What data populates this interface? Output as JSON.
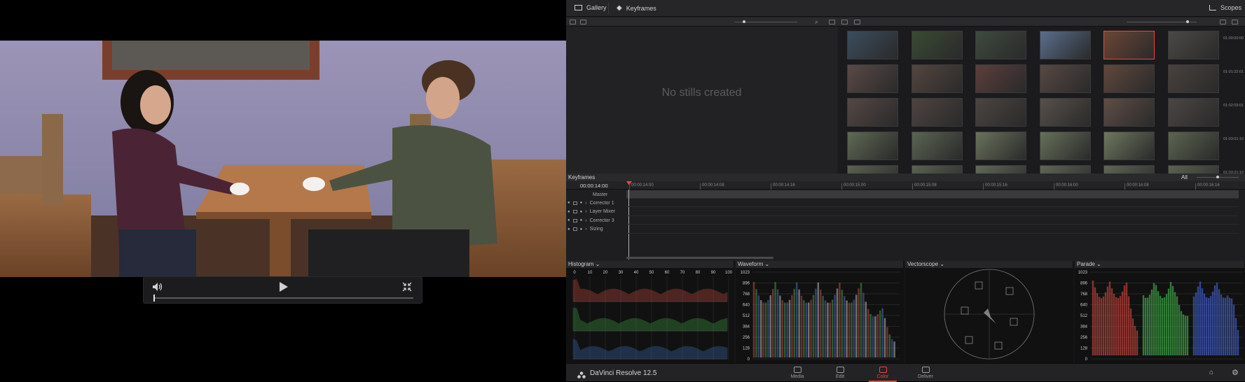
{
  "app": {
    "title": "DaVinci Resolve 12.5"
  },
  "topbar": {
    "gallery": "Gallery",
    "keyframes": "Keyframes",
    "scopes": "Scopes"
  },
  "stills": {
    "empty_message": "No stills created"
  },
  "thumb_timecodes": [
    "01:00:00:00",
    "01:01:32:01",
    "01:02:09:01",
    "01:03:01:10",
    "01:03:21:10"
  ],
  "keyframes": {
    "title": "Keyframes",
    "filter": "All",
    "current_timecode": "00:00:14:00",
    "ruler": [
      "00:00:14:00",
      "00:00:14:08",
      "00:00:14:16",
      "00:00:15:00",
      "00:00:15:08",
      "00:00:15:16",
      "00:00:16:00",
      "00:00:16:08",
      "00:00:16:16"
    ],
    "master_label": "Master",
    "tracks": [
      "Corrector 1",
      "Layer Mixer",
      "Corrector 3",
      "Sizing"
    ]
  },
  "scopes": {
    "histogram": {
      "title": "Histogram",
      "ticks": [
        "0",
        "10",
        "20",
        "30",
        "40",
        "50",
        "60",
        "70",
        "80",
        "90",
        "100"
      ]
    },
    "waveform": {
      "title": "Waveform",
      "ticks": [
        "1023",
        "896",
        "768",
        "640",
        "512",
        "384",
        "256",
        "128",
        "0"
      ]
    },
    "vectorscope": {
      "title": "Vectorscope"
    },
    "parade": {
      "title": "Parade",
      "ticks": [
        "1023",
        "896",
        "768",
        "640",
        "512",
        "384",
        "256",
        "128",
        "0"
      ]
    }
  },
  "pages": [
    {
      "label": "Media",
      "active": false
    },
    {
      "label": "Edit",
      "active": false
    },
    {
      "label": "Color",
      "active": true
    },
    {
      "label": "Deliver",
      "active": false
    }
  ],
  "player": {
    "progress": 0.0
  },
  "colors": {
    "accent": "#e8483f",
    "panel": "#1f1f21",
    "active_page": "#e8483f"
  }
}
